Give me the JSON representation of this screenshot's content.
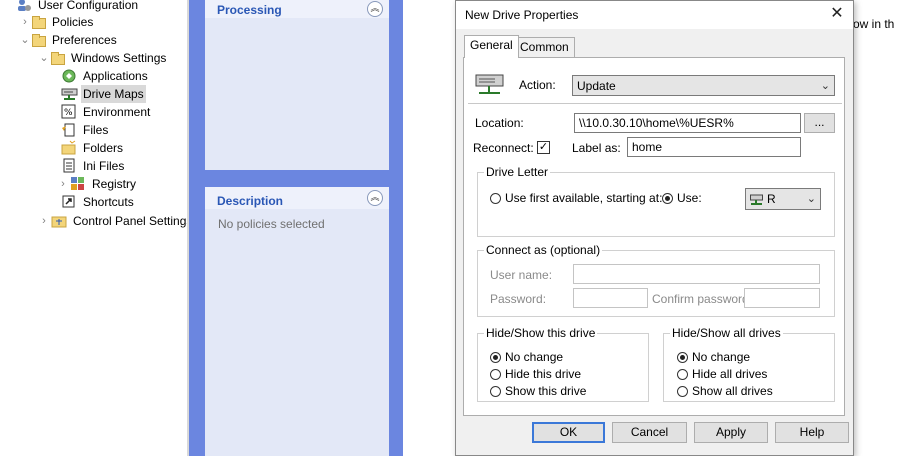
{
  "tree": {
    "items": [
      {
        "label": "User Configuration",
        "expander": "",
        "icon": "user-config-icon"
      },
      {
        "label": "Policies",
        "expander": "›",
        "icon": "folder-icon"
      },
      {
        "label": "Preferences",
        "expander": "⌄",
        "icon": "folder-icon"
      },
      {
        "label": "Windows Settings",
        "expander": "⌄",
        "icon": "folder-icon"
      },
      {
        "label": "Applications",
        "expander": "",
        "icon": "applications-icon"
      },
      {
        "label": "Drive Maps",
        "expander": "",
        "icon": "drive-maps-icon"
      },
      {
        "label": "Environment",
        "expander": "",
        "icon": "environment-icon"
      },
      {
        "label": "Files",
        "expander": "",
        "icon": "files-icon"
      },
      {
        "label": "Folders",
        "expander": "",
        "icon": "folders-icon"
      },
      {
        "label": "Ini Files",
        "expander": "",
        "icon": "ini-files-icon"
      },
      {
        "label": "Registry",
        "expander": "›",
        "icon": "registry-icon"
      },
      {
        "label": "Shortcuts",
        "expander": "",
        "icon": "shortcuts-icon"
      },
      {
        "label": "Control Panel Settings",
        "expander": "›",
        "icon": "folder-icon"
      }
    ]
  },
  "middle": {
    "processing_title": "Processing",
    "description_title": "Description",
    "description_text": "No policies selected",
    "collapse_glyph": "︽"
  },
  "background_text": "ow in th",
  "dialog": {
    "title": "New Drive Properties",
    "close_glyph": "✕",
    "tabs": [
      "General",
      "Common"
    ],
    "action_label": "Action:",
    "action_value": "Update",
    "location_label": "Location:",
    "location_value": "\\\\10.0.30.10\\home\\%UESR%",
    "browse_label": "...",
    "reconnect_label": "Reconnect:",
    "reconnect_check": "✓",
    "label_as_label": "Label as:",
    "label_as_value": "home",
    "drive_letter": {
      "title": "Drive Letter",
      "first_available": "Use first available, starting at:",
      "use": "Use:",
      "letter": "R"
    },
    "connect_as": {
      "title": "Connect as (optional)",
      "username_label": "User name:",
      "password_label": "Password:",
      "confirm_label": "Confirm password:"
    },
    "hide_show_drive": {
      "title": "Hide/Show this drive",
      "options": [
        "No change",
        "Hide this drive",
        "Show this drive"
      ]
    },
    "hide_show_all": {
      "title": "Hide/Show all drives",
      "options": [
        "No change",
        "Hide all drives",
        "Show all drives"
      ]
    },
    "buttons": {
      "ok": "OK",
      "cancel": "Cancel",
      "apply": "Apply",
      "help": "Help"
    },
    "dropdown_glyph": "⌄"
  }
}
